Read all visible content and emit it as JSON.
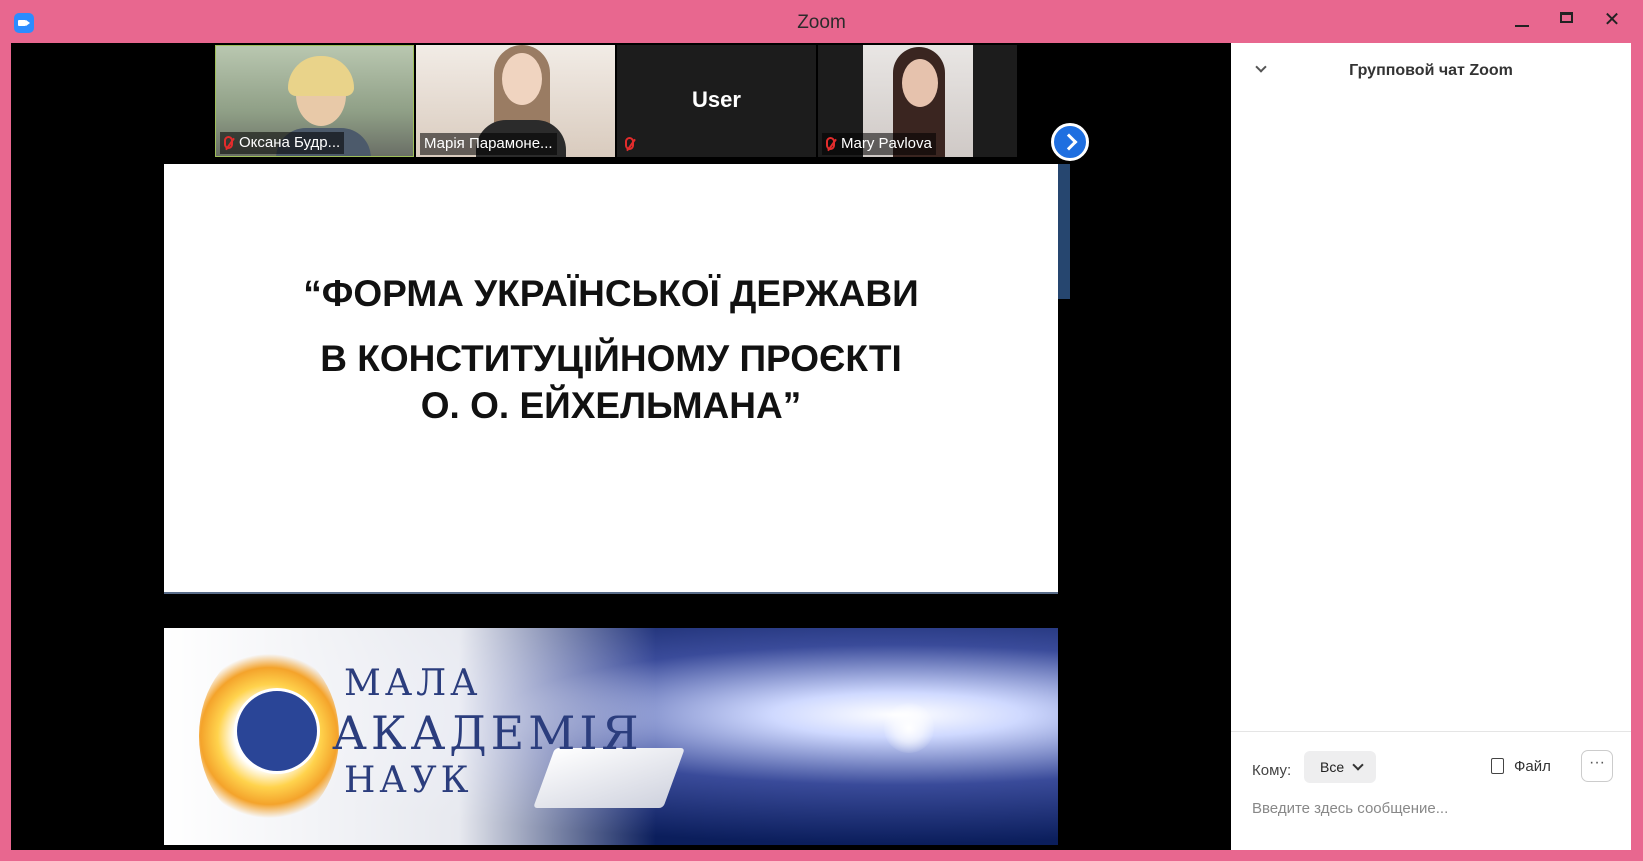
{
  "window": {
    "title": "Zoom",
    "minimize": "minimize",
    "maximize": "maximize",
    "close": "✕",
    "frame_color": "#e8678f"
  },
  "participants": [
    {
      "name": "Оксана Будр...",
      "muted": true
    },
    {
      "name": "Марія Парамоне...",
      "muted": false
    },
    {
      "name": "",
      "display_text": "User",
      "muted": true
    },
    {
      "name": "Mary Pavlova",
      "muted": true
    }
  ],
  "slide": {
    "line1": "“ФОРМА УКРАЇНСЬКОЇ ДЕРЖАВИ",
    "line2": "В КОНСТИТУЦІЙНОМУ ПРОЄКТІ",
    "line3": "О. О. ЕЙХЕЛЬМАНА”",
    "logo": [
      "МАЛА",
      "АКАДЕМІЯ",
      "НАУК"
    ]
  },
  "chat": {
    "title": "Групповой чат Zoom",
    "to_label": "Кому:",
    "to_value": "Все",
    "file_label": "Файл",
    "more_label": "···",
    "input_placeholder": "Введите здесь сообщение..."
  },
  "icons": [
    "zoom-app-icon",
    "mic-off-icon",
    "next-arrow-icon",
    "chevron-down-icon",
    "file-icon",
    "more-icon"
  ]
}
